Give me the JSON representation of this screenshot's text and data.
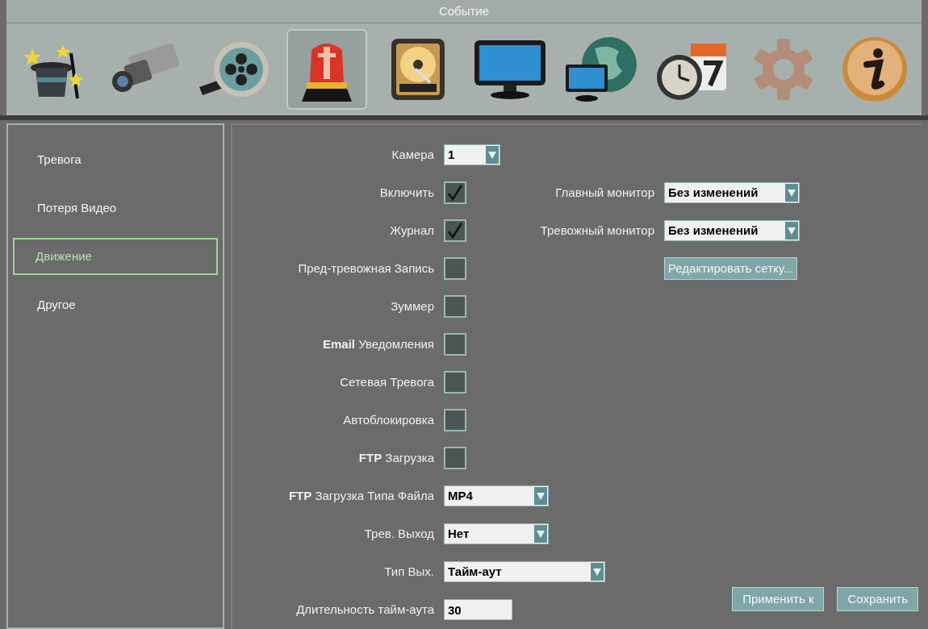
{
  "window": {
    "title": "Событие"
  },
  "toolbar": [
    {
      "kind": "wizard",
      "selected": false
    },
    {
      "kind": "camera",
      "selected": false
    },
    {
      "kind": "film",
      "selected": false
    },
    {
      "kind": "alarm",
      "selected": true
    },
    {
      "kind": "disk",
      "selected": false
    },
    {
      "kind": "monitor",
      "selected": false
    },
    {
      "kind": "network",
      "selected": false
    },
    {
      "kind": "schedule",
      "selected": false
    },
    {
      "kind": "gear",
      "selected": false
    },
    {
      "kind": "info",
      "selected": false
    }
  ],
  "sidebar": {
    "items": [
      {
        "label": "Тревога",
        "selected": false
      },
      {
        "label": "Потеря Видео",
        "selected": false
      },
      {
        "label": "Движение",
        "selected": true
      },
      {
        "label": "Другое",
        "selected": false
      }
    ]
  },
  "form": {
    "fields": [
      {
        "kind": "dropdown",
        "label": "Камера",
        "value": "1"
      },
      {
        "kind": "checkbox",
        "label": "Включить",
        "checked": true,
        "extra": {
          "kind": "dropdown",
          "label": "Главный монитор",
          "value": "Без изменений"
        }
      },
      {
        "kind": "checkbox",
        "label": "Журнал",
        "checked": true,
        "extra": {
          "kind": "dropdown",
          "label": "Тревожный монитор",
          "value": "Без изменений"
        }
      },
      {
        "kind": "checkbox",
        "label": "Пред-тревожная Запись",
        "checked": false,
        "extra": {
          "kind": "button",
          "label": "Редактировать сетку..."
        }
      },
      {
        "kind": "checkbox",
        "label": "Зуммер",
        "checked": false
      },
      {
        "kind": "checkbox",
        "label": "**Email** Уведомления",
        "checked": false
      },
      {
        "kind": "checkbox",
        "label": "Сетевая Тревога",
        "checked": false
      },
      {
        "kind": "checkbox",
        "label": "Автоблокировка",
        "checked": false
      },
      {
        "kind": "checkbox",
        "label": "**FTP** Загрузка",
        "checked": false
      },
      {
        "kind": "dropdown",
        "label": "**FTP** Загрузка Типа Файла",
        "value": "MP4"
      },
      {
        "kind": "dropdown",
        "label": "Трев. Выход",
        "value": "Нет"
      },
      {
        "kind": "dropdown",
        "label": "Тип Вых.",
        "value": "Тайм-аут"
      },
      {
        "kind": "input",
        "label": "Длительность тайм-аута",
        "value": "30"
      }
    ],
    "buttons": [
      "Применить к",
      "Сохранить"
    ]
  }
}
